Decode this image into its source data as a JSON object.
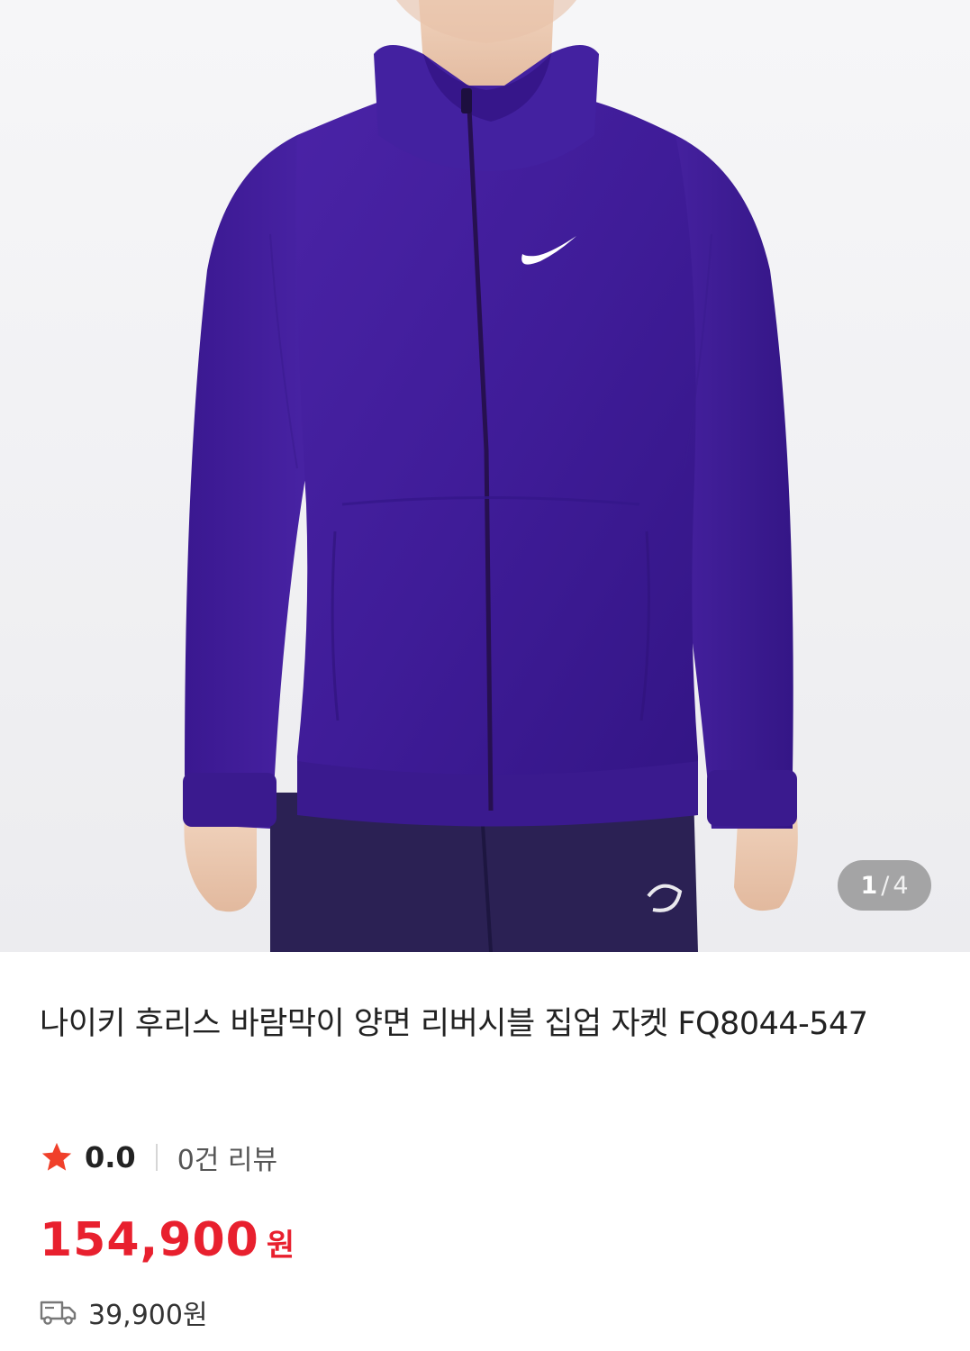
{
  "gallery": {
    "current_page": "1",
    "separator": "/",
    "total_pages": "4",
    "image_icon": "product-photo-icon"
  },
  "product": {
    "title": "나이키 후리스 바람막이 양면 리버시블 집업 자켓 FQ8044-547"
  },
  "rating": {
    "icon": "star-icon",
    "value": "0.0",
    "review_count": "0건 리뷰",
    "star_color": "#f0402a"
  },
  "price": {
    "amount": "154,900",
    "unit": "원",
    "color": "#e8202e"
  },
  "shipping": {
    "icon": "truck-icon",
    "fee": "39,900원"
  }
}
